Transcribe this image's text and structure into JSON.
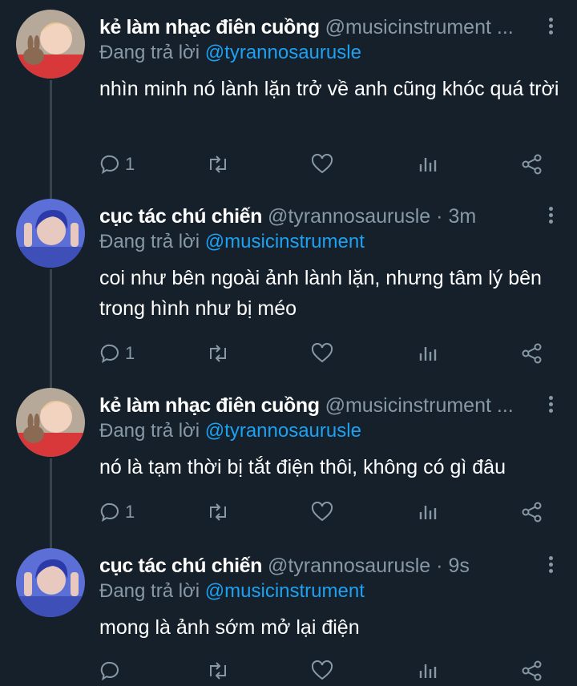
{
  "tweets": [
    {
      "name": "kẻ làm nhạc điên cuồng",
      "handle": "@musicinstrument ...",
      "time": "",
      "reply_prefix": "Đang trả lời",
      "reply_to": "@tyrannosaurusle",
      "text": "nhìn minh nó lành lặn trở về anh cũng khóc quá trời",
      "reply_count": "1",
      "avatar": "rabbit-boy-avatar"
    },
    {
      "name": "cục tác chú chiến",
      "handle": "@tyrannosaurusle",
      "time": "· 3m",
      "reply_prefix": "Đang trả lời",
      "reply_to": "@musicinstrument",
      "text": "coi như bên ngoài ảnh lành lặn, nhưng tâm lý bên trong hình như bị méo",
      "reply_count": "1",
      "avatar": "blue-hair-boy-avatar"
    },
    {
      "name": "kẻ làm nhạc điên cuồng",
      "handle": "@musicinstrument ...",
      "time": "",
      "reply_prefix": "Đang trả lời",
      "reply_to": "@tyrannosaurusle",
      "text": "nó là tạm thời bị tắt điện thôi, không có gì đâu",
      "reply_count": "1",
      "avatar": "rabbit-boy-avatar"
    },
    {
      "name": "cục tác chú chiến",
      "handle": "@tyrannosaurusle",
      "time": "· 9s",
      "reply_prefix": "Đang trả lời",
      "reply_to": "@musicinstrument",
      "text": "mong là ảnh sớm mở lại điện",
      "reply_count": "",
      "avatar": "blue-hair-boy-avatar"
    }
  ],
  "colors": {
    "background": "#15202b",
    "secondary_text": "#8899a6",
    "link": "#1da1f2",
    "thread_line": "#38444d"
  }
}
